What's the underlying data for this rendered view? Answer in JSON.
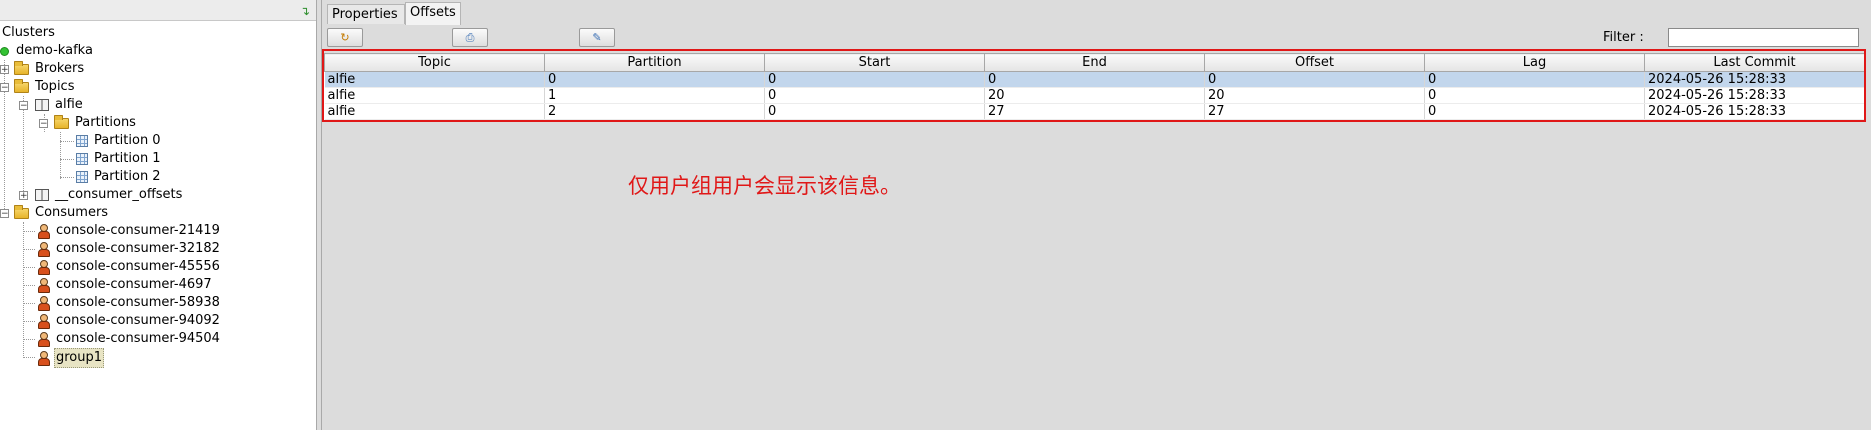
{
  "tree": {
    "root_label": "Clusters",
    "cluster": "demo-kafka",
    "brokers": "Brokers",
    "topics": "Topics",
    "topic_alfie": "alfie",
    "partitions_folder": "Partitions",
    "partitions": [
      "Partition 0",
      "Partition 1",
      "Partition 2"
    ],
    "consumer_offsets": "__consumer_offsets",
    "consumers_folder": "Consumers",
    "consumers": [
      "console-consumer-21419",
      "console-consumer-32182",
      "console-consumer-45556",
      "console-consumer-4697",
      "console-consumer-58938",
      "console-consumer-94092",
      "console-consumer-94504",
      "group1"
    ]
  },
  "tabs": [
    "Properties",
    "Offsets"
  ],
  "active_tab": "Offsets",
  "filter": {
    "label": "Filter :",
    "value": ""
  },
  "table": {
    "columns": [
      "Topic",
      "Partition",
      "Start",
      "End",
      "Offset",
      "Lag",
      "Last Commit"
    ],
    "rows": [
      [
        "alfie",
        "0",
        "0",
        "0",
        "0",
        "0",
        "2024-05-26 15:28:33"
      ],
      [
        "alfie",
        "1",
        "0",
        "20",
        "20",
        "0",
        "2024-05-26 15:28:33"
      ],
      [
        "alfie",
        "2",
        "0",
        "27",
        "27",
        "0",
        "2024-05-26 15:28:33"
      ]
    ]
  },
  "annotation_note": "仅用户组用户会显示该信息。",
  "colors": {
    "annotation_red": "#e01818",
    "selection_blue": "#c2d6ec",
    "status_green": "#33c233"
  },
  "icons": {
    "refresh": "refresh-icon",
    "folder": "folder-icon",
    "topic": "book-icon",
    "partition": "grid-icon",
    "consumer": "person-icon"
  }
}
